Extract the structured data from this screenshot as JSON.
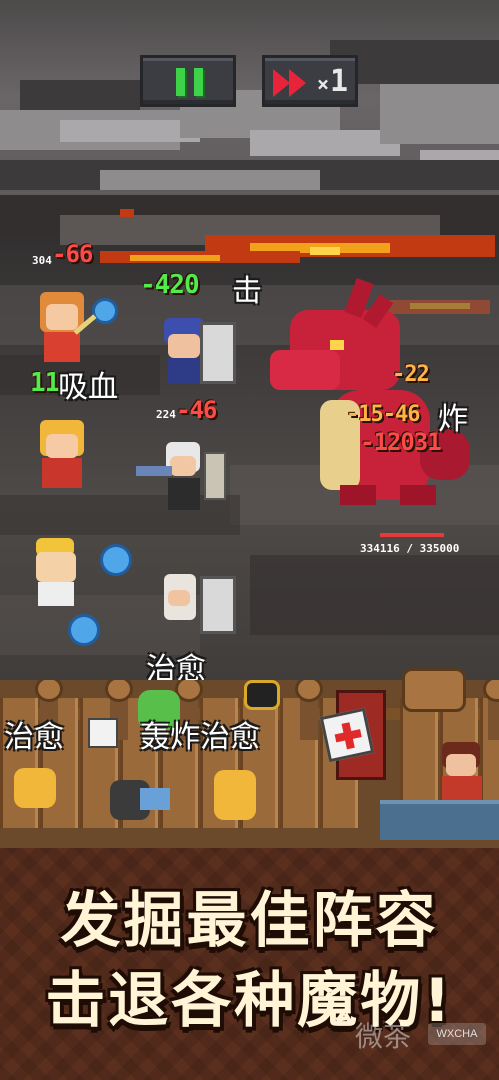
{
  "controls": {
    "pause_icon": "pause-icon",
    "speed_icon": "fast-forward-icon",
    "speed_prefix": "×",
    "speed_value": "1"
  },
  "battle": {
    "hero_hp_label": "304",
    "ally_hp_label": "224",
    "damage_numbers": [
      "-66",
      "-420",
      "-46",
      "-22",
      "-15-46",
      "-12031",
      "11"
    ],
    "skill_labels": {
      "strike": "击",
      "lifesteal": "吸血",
      "explode": "炸",
      "heal": "治愈",
      "heal_left": "治愈",
      "blast_heal": "轰炸治愈"
    },
    "boss_hp": {
      "current": 334116,
      "max": 335000,
      "text": "334116 / 335000"
    }
  },
  "promo": {
    "line1": "发掘最佳阵容",
    "line2": "击退各种魔物!"
  },
  "watermark": {
    "text": "微茶",
    "badge": "WXCHA"
  },
  "colors": {
    "damage_red": "#ff4b47",
    "heal_green": "#54ea4c",
    "crit_orange": "#ffb446",
    "promo_text": "#fff4d6"
  }
}
